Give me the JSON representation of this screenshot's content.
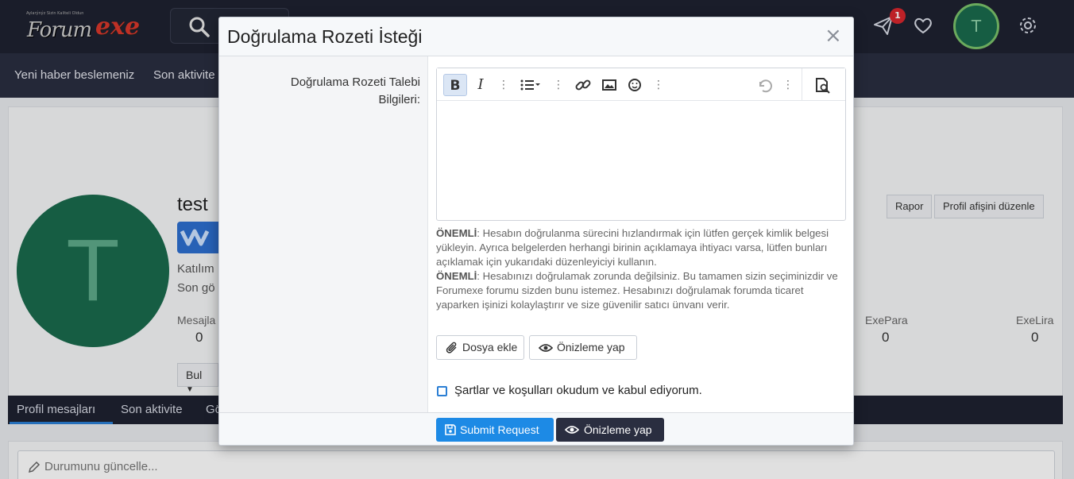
{
  "header": {
    "logo_tagline": "Aylarýnýz Sizin Kaliteli Oldun",
    "logo_forum": "Forum",
    "logo_exe": "exe",
    "notification_count": "1",
    "avatar_letter": "T"
  },
  "nav": {
    "items": [
      "Yeni haber beslemeniz",
      "Son aktivite"
    ]
  },
  "profile": {
    "username": "test",
    "avatar_letter": "T",
    "joined_label": "Katılım",
    "last_seen_label": "Son gö",
    "buttons": {
      "report": "Rapor",
      "edit_banner": "Profil afişini düzenle"
    },
    "stats": [
      {
        "label": "Mesajla",
        "value": "0"
      },
      {
        "label": "ExePara",
        "value": "0"
      },
      {
        "label": "ExeLira",
        "value": "0"
      }
    ],
    "find_button": "Bul",
    "tabs": [
      "Profil mesajları",
      "Son aktivite",
      "Gö"
    ],
    "status_placeholder": "Durumunu güncelle..."
  },
  "modal": {
    "title": "Doğrulama Rozeti İsteği",
    "close": "×",
    "field_label": "Doğrulama Rozeti Talebi Bilgileri:",
    "toolbar": {
      "bold": "B",
      "italic": "I",
      "more": "⋮"
    },
    "notice_1_title": "ÖNEMLİ",
    "notice_1_text": ": Hesabın doğrulanma sürecini hızlandırmak için lütfen gerçek kimlik belgesi yükleyin. Ayrıca belgelerden herhangi birinin açıklamaya ihtiyacı varsa, lütfen bunları açıklamak için yukarıdaki düzenleyiciyi kullanın.",
    "notice_2_title": "ÖNEMLİ",
    "notice_2_text": ": Hesabınızı doğrulamak zorunda değilsiniz. Bu tamamen sizin seçiminizdir ve Forumexe forumu sizden bunu istemez. Hesabınızı doğrulamak forumda ticaret yaparken işinizi kolaylaştırır ve size güvenilir satıcı ünvanı verir.",
    "attach_button": "Dosya ekle",
    "preview_button": "Önizleme yap",
    "terms_label": "Şartlar ve koşulları okudum ve kabul ediyorum.",
    "submit_button": "Submit Request",
    "footer_preview_button": "Önizleme yap"
  },
  "colors": {
    "header_bg": "#1e2130",
    "primary": "#1d8ae5",
    "avatar_green": "#1a6a4d",
    "badge_red": "#d8262d"
  }
}
